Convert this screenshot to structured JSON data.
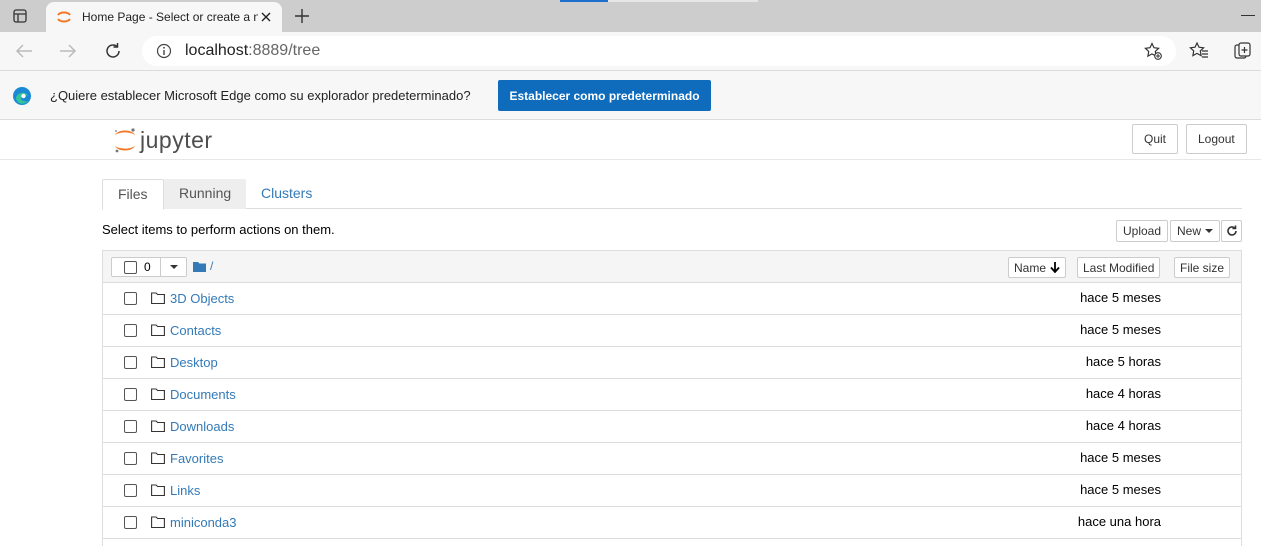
{
  "browser": {
    "tab_title": "Home Page - Select or create a n",
    "url_host": "localhost",
    "url_rest": ":8889/tree",
    "accent": "#0f6cbd"
  },
  "infobar": {
    "message": "¿Quiere establecer Microsoft Edge como su explorador predeterminado?",
    "button": "Establecer como predeterminado"
  },
  "jupyter": {
    "logo_text": "jupyter",
    "quit": "Quit",
    "logout": "Logout"
  },
  "tabs": [
    "Files",
    "Running",
    "Clusters"
  ],
  "hint": "Select items to perform actions on them.",
  "actions": {
    "upload": "Upload",
    "new": "New"
  },
  "list": {
    "selected_count": "0",
    "breadcrumb": "/",
    "columns": {
      "name": "Name",
      "modified": "Last Modified",
      "size": "File size"
    },
    "rows": [
      {
        "name": "3D Objects",
        "modified": "hace 5 meses"
      },
      {
        "name": "Contacts",
        "modified": "hace 5 meses"
      },
      {
        "name": "Desktop",
        "modified": "hace 5 horas"
      },
      {
        "name": "Documents",
        "modified": "hace 4 horas"
      },
      {
        "name": "Downloads",
        "modified": "hace 4 horas"
      },
      {
        "name": "Favorites",
        "modified": "hace 5 meses"
      },
      {
        "name": "Links",
        "modified": "hace 5 meses"
      },
      {
        "name": "miniconda3",
        "modified": "hace una hora"
      }
    ]
  }
}
